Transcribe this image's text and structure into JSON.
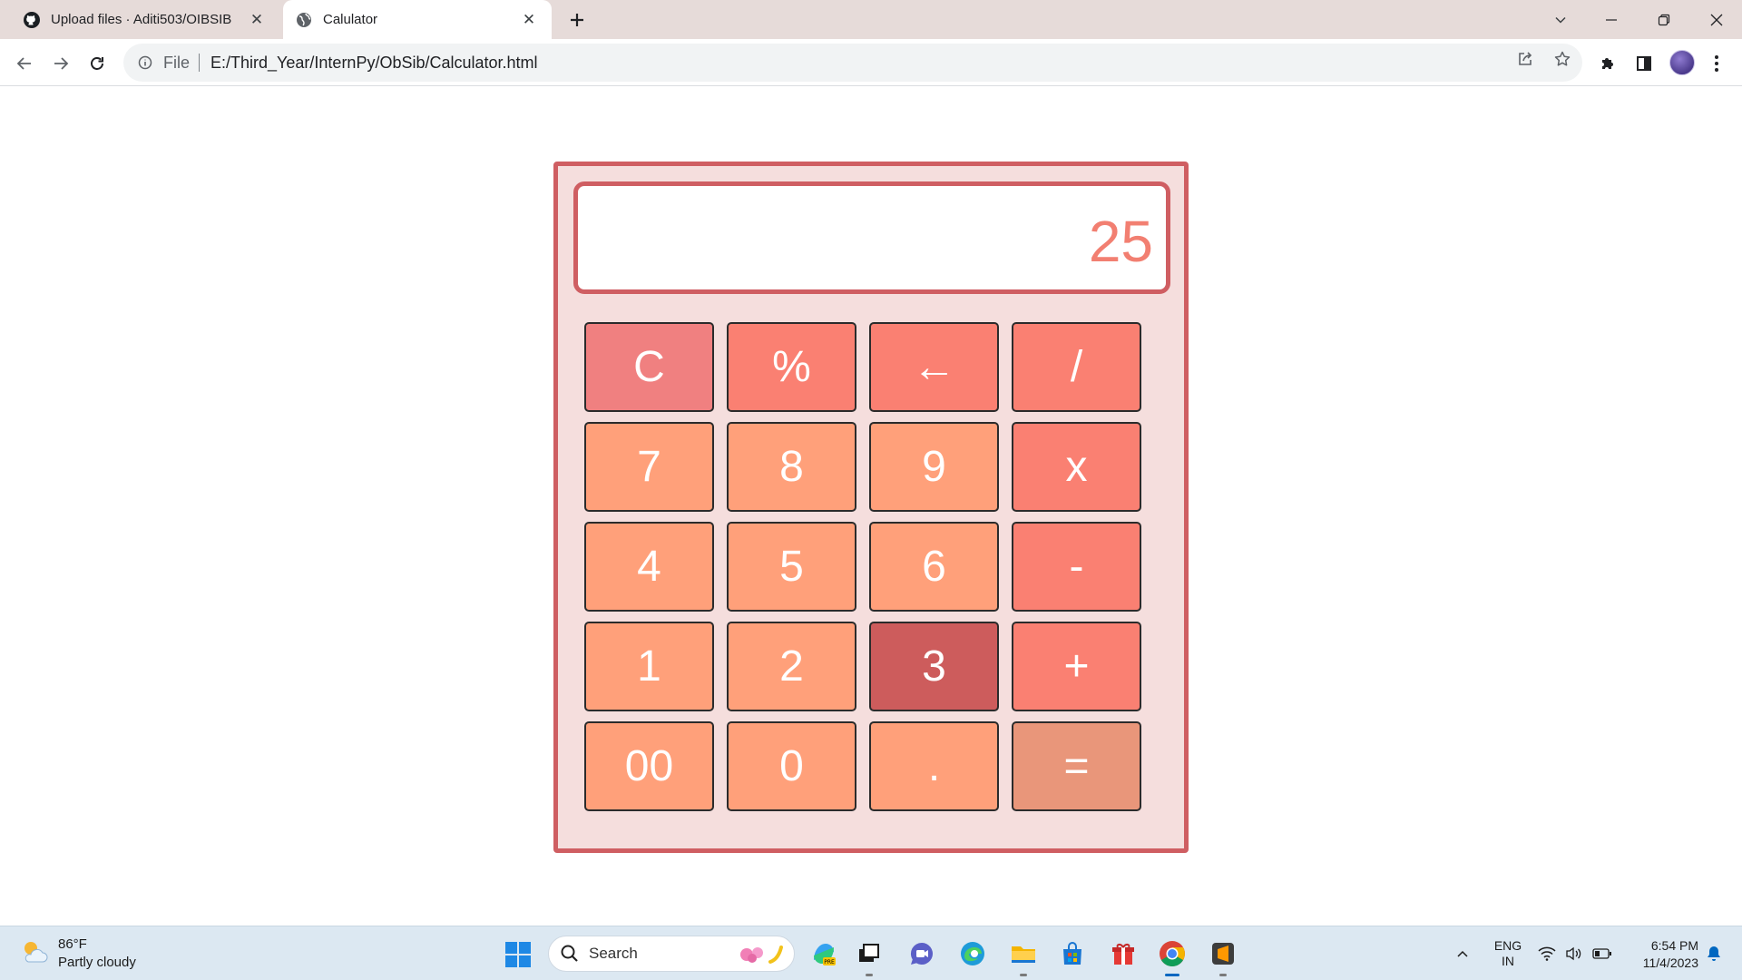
{
  "browser": {
    "tabs": [
      {
        "title": "Upload files · Aditi503/OIBSIB",
        "icon": "github-icon",
        "active": false
      },
      {
        "title": "Calulator",
        "icon": "globe-icon",
        "active": true
      }
    ],
    "address_bar": {
      "scheme_label": "File",
      "url": "E:/Third_Year/InternPy/ObSib/Calculator.html"
    }
  },
  "calculator": {
    "display_value": "25",
    "colors": {
      "frame": "#cf5e62",
      "panel": "#f5dedd",
      "display_text": "#f27f71",
      "clear": "#f08080",
      "operator": "#fa8072",
      "number": "#ffa07a",
      "pressed": "#cd5c5c",
      "equals": "#e9967a"
    },
    "keys": [
      {
        "label": "C",
        "type": "clear"
      },
      {
        "label": "%",
        "type": "operator"
      },
      {
        "label": "←",
        "type": "operator"
      },
      {
        "label": "/",
        "type": "operator"
      },
      {
        "label": "7",
        "type": "number"
      },
      {
        "label": "8",
        "type": "number"
      },
      {
        "label": "9",
        "type": "number"
      },
      {
        "label": "x",
        "type": "operator"
      },
      {
        "label": "4",
        "type": "number"
      },
      {
        "label": "5",
        "type": "number"
      },
      {
        "label": "6",
        "type": "number"
      },
      {
        "label": "-",
        "type": "operator"
      },
      {
        "label": "1",
        "type": "number"
      },
      {
        "label": "2",
        "type": "number"
      },
      {
        "label": "3",
        "type": "number",
        "pressed": true
      },
      {
        "label": "+",
        "type": "operator"
      },
      {
        "label": "00",
        "type": "number"
      },
      {
        "label": "0",
        "type": "number"
      },
      {
        "label": ".",
        "type": "number"
      },
      {
        "label": "=",
        "type": "equals"
      }
    ]
  },
  "taskbar": {
    "weather": {
      "temp": "86°F",
      "condition": "Partly cloudy"
    },
    "search_placeholder": "Search",
    "tray": {
      "lang_top": "ENG",
      "lang_bottom": "IN"
    },
    "clock": {
      "time": "6:54 PM",
      "date": "11/4/2023"
    }
  }
}
